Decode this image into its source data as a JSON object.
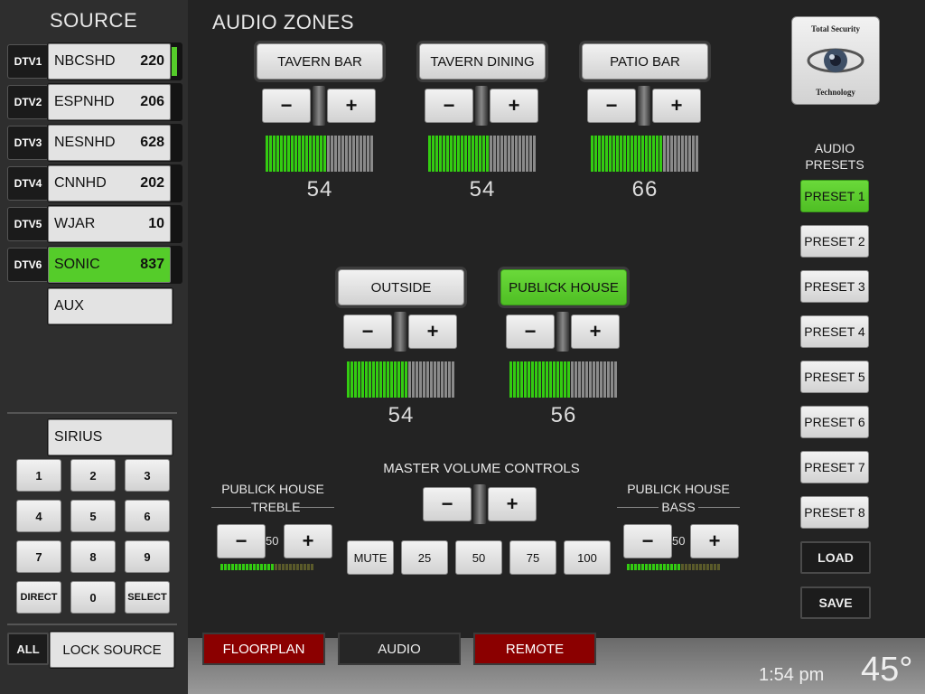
{
  "sidebar": {
    "title": "SOURCE",
    "sources": [
      {
        "id": "DTV1",
        "name": "NBCSHD",
        "channel": "220",
        "active": false,
        "indicator": true
      },
      {
        "id": "DTV2",
        "name": "ESPNHD",
        "channel": "206",
        "active": false,
        "indicator": false
      },
      {
        "id": "DTV3",
        "name": "NESNHD",
        "channel": "628",
        "active": false,
        "indicator": false
      },
      {
        "id": "DTV4",
        "name": "CNNHD",
        "channel": "202",
        "active": false,
        "indicator": false
      },
      {
        "id": "DTV5",
        "name": "WJAR",
        "channel": "10",
        "active": false,
        "indicator": false
      },
      {
        "id": "DTV6",
        "name": "SONIC",
        "channel": "837",
        "active": true,
        "indicator": false
      }
    ],
    "aux_label": "AUX",
    "sirius_label": "SIRIUS",
    "keypad": [
      "1",
      "2",
      "3",
      "4",
      "5",
      "6",
      "7",
      "8",
      "9",
      "DIRECT",
      "0",
      "SELECT"
    ],
    "all_label": "ALL",
    "lock_label": "LOCK SOURCE"
  },
  "audio_zones": {
    "title": "AUDIO ZONES",
    "zones": [
      {
        "name": "TAVERN BAR",
        "level": "54",
        "active": false
      },
      {
        "name": "TAVERN DINING",
        "level": "54",
        "active": false
      },
      {
        "name": "PATIO BAR",
        "level": "66",
        "active": false
      },
      {
        "name": "OUTSIDE",
        "level": "54",
        "active": false
      },
      {
        "name": "PUBLICK HOUSE",
        "level": "56",
        "active": true
      }
    ],
    "minus_symbol": "−",
    "plus_symbol": "+"
  },
  "master": {
    "title": "MASTER VOLUME CONTROLS",
    "treble_label_1": "PUBLICK HOUSE",
    "treble_label_2": "TREBLE",
    "treble_value": "50",
    "bass_label_1": "PUBLICK HOUSE",
    "bass_label_2": "BASS",
    "bass_value": "50",
    "buttons": [
      "MUTE",
      "25",
      "50",
      "75",
      "100"
    ]
  },
  "presets": {
    "title_1": "AUDIO",
    "title_2": "PRESETS",
    "items": [
      "PRESET 1",
      "PRESET 2",
      "PRESET 3",
      "PRESET 4",
      "PRESET 5",
      "PRESET 6",
      "PRESET 7",
      "PRESET 8"
    ],
    "active_index": 0,
    "load_label": "LOAD",
    "save_label": "SAVE"
  },
  "logo": {
    "line1": "Total Security",
    "line2": "Technology"
  },
  "tabs": [
    {
      "label": "FLOORPLAN",
      "style": "red"
    },
    {
      "label": "AUDIO",
      "style": "dark"
    },
    {
      "label": "REMOTE",
      "style": "red"
    }
  ],
  "status": {
    "time": "1:54 pm",
    "temperature": "45°"
  },
  "colors": {
    "active_green": "#55cc2a",
    "meter_green": "#33cc11",
    "meter_grey": "#8a8a8a",
    "tab_red": "#8b0000"
  }
}
